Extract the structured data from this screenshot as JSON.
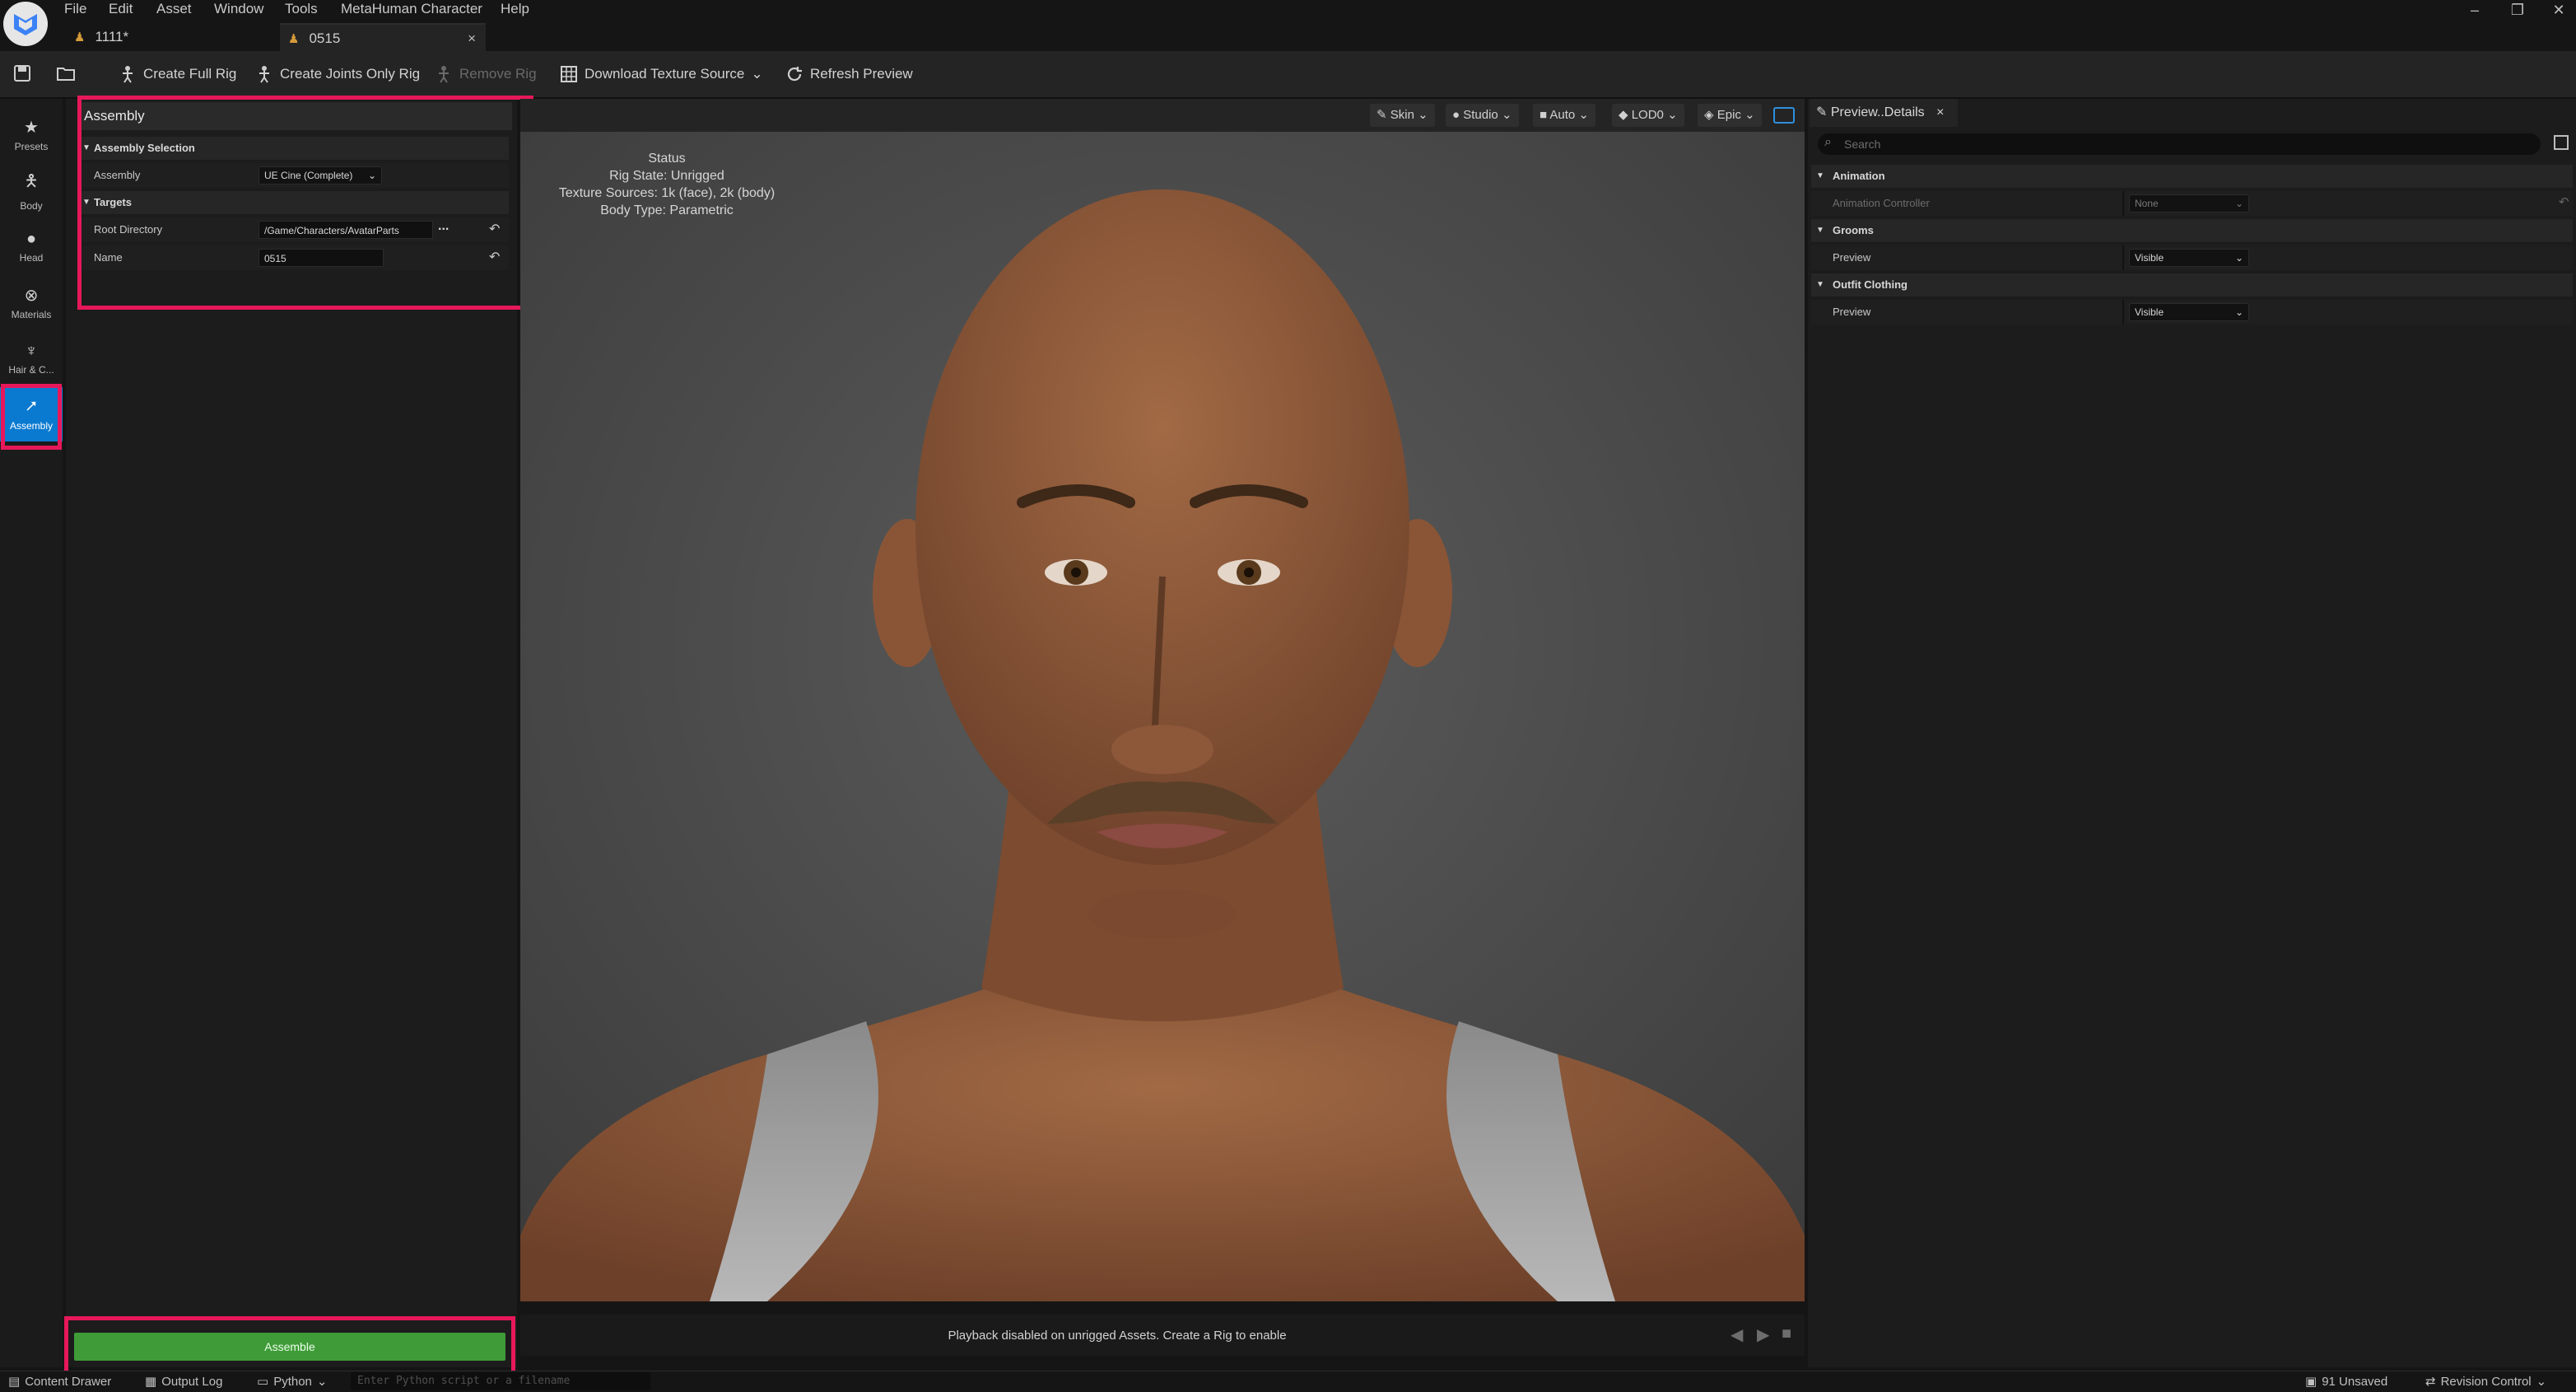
{
  "menu": [
    "File",
    "Edit",
    "Asset",
    "Window",
    "Tools",
    "MetaHuman Character",
    "Help"
  ],
  "tabs": [
    {
      "label": "1111*",
      "active": false
    },
    {
      "label": "0515",
      "active": true,
      "close": "×"
    }
  ],
  "window_controls": {
    "minimize": "–",
    "restore": "❐",
    "close": "✕"
  },
  "toolbar": {
    "create_full_rig": "Create Full Rig",
    "create_joints_only_rig": "Create Joints Only Rig",
    "remove_rig": "Remove Rig",
    "download_texture_source": "Download Texture Source",
    "refresh_preview": "Refresh Preview"
  },
  "rail": [
    {
      "label": "Presets",
      "icon": "star-icon"
    },
    {
      "label": "Body",
      "icon": "body-icon"
    },
    {
      "label": "Head",
      "icon": "head-icon"
    },
    {
      "label": "Materials",
      "icon": "materials-icon"
    },
    {
      "label": "Hair & C...",
      "icon": "hair-icon"
    },
    {
      "label": "Assembly",
      "icon": "assembly-icon",
      "active": true
    }
  ],
  "left_panel": {
    "title": "Assembly",
    "assembly_selection": {
      "header": "Assembly Selection",
      "label": "Assembly",
      "value": "UE Cine (Complete)"
    },
    "targets": {
      "header": "Targets",
      "root_directory_label": "Root Directory",
      "root_directory_value": "/Game/Characters/AvatarParts",
      "browse": "...",
      "name_label": "Name",
      "name_value": "0515"
    },
    "assemble_button": "Assemble"
  },
  "viewport": {
    "buttons": {
      "skin": "Skin",
      "studio": "Studio",
      "auto": "Auto",
      "lod": "LOD0",
      "epic": "Epic"
    },
    "status": {
      "title": "Status",
      "rig_state": "Rig State: Unrigged",
      "texture_sources": "Texture Sources: 1k (face), 2k (body)",
      "body_type": "Body Type: Parametric"
    },
    "playback_message": "Playback disabled on unrigged Assets. Create a Rig to enable",
    "skin_color": "#8a5a3c",
    "background_color": "#4a4a4a"
  },
  "details_panel": {
    "tab_label": "Preview..Details",
    "tab_close": "×",
    "search_placeholder": "Search",
    "sections": {
      "animation": {
        "header": "Animation",
        "label": "Animation Controller",
        "value": "None"
      },
      "grooms": {
        "header": "Grooms",
        "label": "Preview",
        "value": "Visible"
      },
      "outfit": {
        "header": "Outfit Clothing",
        "label": "Preview",
        "value": "Visible"
      }
    }
  },
  "statusbar": {
    "content_drawer": "Content Drawer",
    "output_log": "Output Log",
    "python": "Python",
    "python_placeholder": "Enter Python script or a filename",
    "unsaved": "91 Unsaved",
    "revision_control": "Revision Control"
  },
  "colors": {
    "highlight": "#e7185a",
    "accent_blue": "#0a7ad1",
    "assemble_green": "#3f9b38"
  }
}
